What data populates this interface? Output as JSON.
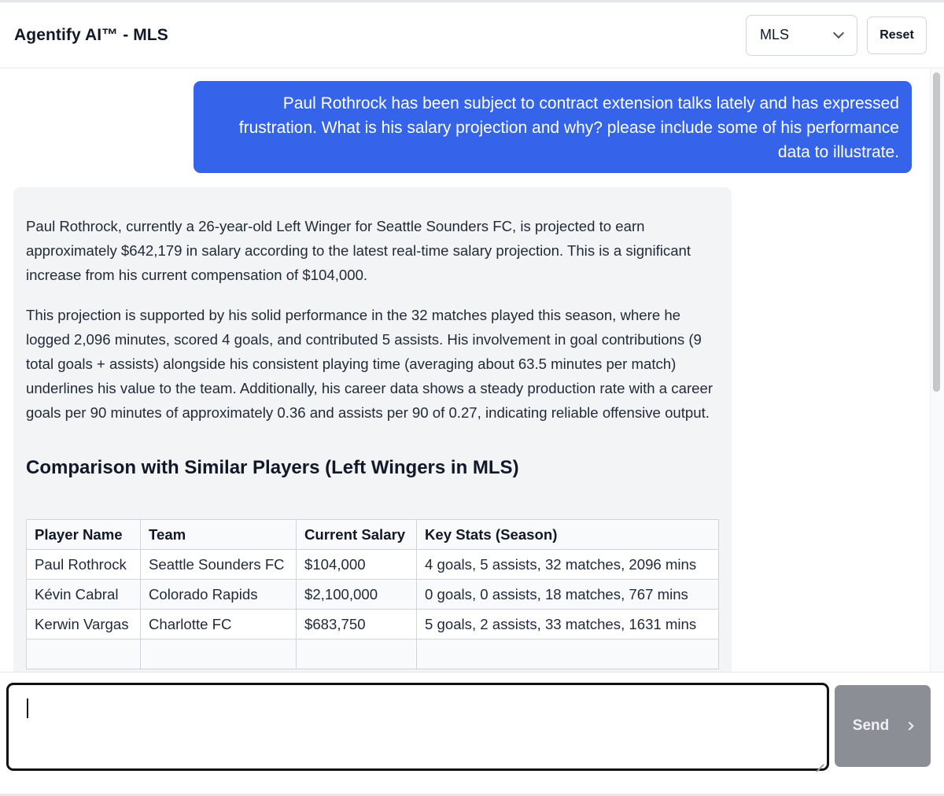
{
  "header": {
    "title": "Agentify AI™ - MLS",
    "league_select": {
      "value": "MLS",
      "icon": "chevron-down-icon"
    },
    "reset_label": "Reset"
  },
  "chat": {
    "user_message": "Paul Rothrock has been subject to contract extension talks lately and has expressed frustration. What is his salary projection and why? please include some of his performance data to illustrate.",
    "assistant": {
      "paragraphs": [
        "Paul Rothrock, currently a 26-year-old Left Winger for Seattle Sounders FC, is projected to earn approximately $642,179 in salary according to the latest real-time salary projection. This is a significant increase from his current compensation of $104,000.",
        "This projection is supported by his solid performance in the 32 matches played this season, where he logged 2,096 minutes, scored 4 goals, and contributed 5 assists. His involvement in goal contributions (9 total goals + assists) alongside his consistent playing time (averaging about 63.5 minutes per match) underlines his value to the team. Additionally, his career data shows a steady production rate with a career goals per 90 minutes of approximately 0.36 and assists per 90 of 0.27, indicating reliable offensive output."
      ],
      "heading": "Comparison with Similar Players (Left Wingers in MLS)",
      "table": {
        "headers": [
          "Player Name",
          "Team",
          "Current Salary",
          "Key Stats (Season)"
        ],
        "rows": [
          [
            "Paul Rothrock",
            "Seattle Sounders FC",
            "$104,000",
            "4 goals, 5 assists, 32 matches, 2096 mins"
          ],
          [
            "Kévin Cabral",
            "Colorado Rapids",
            "$2,100,000",
            "0 goals, 0 assists, 18 matches, 767 mins"
          ],
          [
            "Kerwin Vargas",
            "Charlotte FC",
            "$683,750",
            "5 goals, 2 assists, 33 matches, 1631 mins"
          ]
        ]
      }
    }
  },
  "composer": {
    "input_value": "",
    "placeholder": "",
    "send_label": "Send",
    "send_icon": "chevron-right-icon"
  },
  "colors": {
    "user_bubble": "#3563e9",
    "assistant_bubble": "#f3f4f6",
    "send_button": "#8b8e94"
  }
}
